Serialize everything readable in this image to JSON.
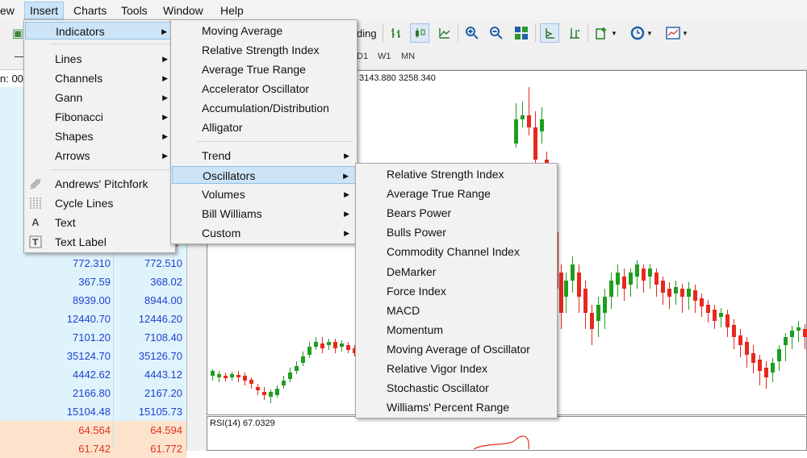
{
  "menubar": {
    "items": [
      "ew",
      "Insert",
      "Charts",
      "Tools",
      "Window",
      "Help"
    ]
  },
  "toolbar": {
    "partial_label": "ding",
    "timeframes": [
      "D1",
      "W1",
      "MN"
    ],
    "left_stub": "n: 00"
  },
  "insert_menu": {
    "items": [
      {
        "label": "Indicators",
        "submenu": true
      },
      {
        "label": "Lines",
        "submenu": true
      },
      {
        "label": "Channels",
        "submenu": true
      },
      {
        "label": "Gann",
        "submenu": true
      },
      {
        "label": "Fibonacci",
        "submenu": true
      },
      {
        "label": "Shapes",
        "submenu": true
      },
      {
        "label": "Arrows",
        "submenu": true
      },
      {
        "label": "Andrews' Pitchfork",
        "icon": "pitchfork-icon"
      },
      {
        "label": "Cycle Lines",
        "icon": "cycle-lines-icon"
      },
      {
        "label": "Text",
        "icon": "text-icon"
      },
      {
        "label": "Text Label",
        "icon": "text-label-icon"
      }
    ]
  },
  "indicators_menu": {
    "items": [
      {
        "label": "Moving Average"
      },
      {
        "label": "Relative Strength Index"
      },
      {
        "label": "Average True Range"
      },
      {
        "label": "Accelerator Oscillator"
      },
      {
        "label": "Accumulation/Distribution"
      },
      {
        "label": "Alligator"
      },
      {
        "label": "Trend",
        "submenu": true
      },
      {
        "label": "Oscillators",
        "submenu": true
      },
      {
        "label": "Volumes",
        "submenu": true
      },
      {
        "label": "Bill Williams",
        "submenu": true
      },
      {
        "label": "Custom",
        "submenu": true
      }
    ]
  },
  "oscillators_menu": {
    "items": [
      "Relative Strength Index",
      "Average True Range",
      "Bears Power",
      "Bulls Power",
      "Commodity Channel Index",
      "DeMarker",
      "Force Index",
      "MACD",
      "Momentum",
      "Moving Average of Oscillator",
      "Relative Vigor Index",
      "Stochastic Oscillator",
      "Williams' Percent Range"
    ]
  },
  "market_watch": {
    "rows": [
      {
        "bid": "772.310",
        "ask": "772.510",
        "bg": "#dff3fb",
        "color": "#1f3fd0"
      },
      {
        "bid": "367.59",
        "ask": "368.02",
        "bg": "#dff3fb",
        "color": "#1f3fd0"
      },
      {
        "bid": "8939.00",
        "ask": "8944.00",
        "bg": "#dff3fb",
        "color": "#1f3fd0"
      },
      {
        "bid": "12440.70",
        "ask": "12446.20",
        "bg": "#dff3fb",
        "color": "#1f3fd0"
      },
      {
        "bid": "7101.20",
        "ask": "7108.40",
        "bg": "#dff3fb",
        "color": "#1f3fd0"
      },
      {
        "bid": "35124.70",
        "ask": "35126.70",
        "bg": "#dff3fb",
        "color": "#1f3fd0"
      },
      {
        "bid": "4442.62",
        "ask": "4443.12",
        "bg": "#dff3fb",
        "color": "#1f3fd0"
      },
      {
        "bid": "2166.80",
        "ask": "2167.20",
        "bg": "#dff3fb",
        "color": "#1f3fd0"
      },
      {
        "bid": "15104.48",
        "ask": "15105.73",
        "bg": "#dff3fb",
        "color": "#1f3fd0"
      },
      {
        "bid": "64.564",
        "ask": "64.594",
        "bg": "#fde3cc",
        "color": "#e03020"
      },
      {
        "bid": "61.742",
        "ask": "61.772",
        "bg": "#fde3cc",
        "color": "#e03020"
      }
    ],
    "partial_digit": "0"
  },
  "chart": {
    "header": "3143.880 3258.340",
    "rsi_label": "RSI(14) 67.0329",
    "bull_color": "#1f9d1f",
    "bear_color": "#e8281f"
  },
  "colors": {
    "highlight": "#cde4f7",
    "menu_bg": "#f2f2f2"
  }
}
